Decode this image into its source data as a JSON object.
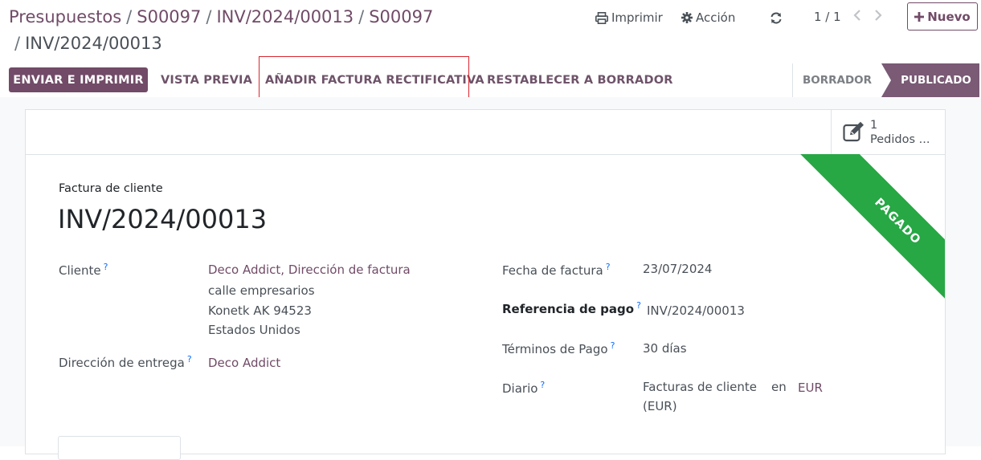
{
  "breadcrumb": {
    "items": [
      "Presupuestos",
      "S00097",
      "INV/2024/00013",
      "S00097"
    ],
    "current": "INV/2024/00013",
    "separator": "/"
  },
  "toolbar": {
    "print_label": "Imprimir",
    "action_label": "Acción",
    "pager": "1 / 1",
    "new_label": "Nuevo"
  },
  "statusbar": {
    "send_print": "ENVIAR E IMPRIMIR",
    "preview": "VISTA PREVIA",
    "credit_note": "AÑADIR FACTURA RECTIFICATIVA",
    "reset_draft": "RESTABLECER A BORRADOR",
    "stages": [
      "BORRADOR",
      "PUBLICADO"
    ],
    "active_stage": "PUBLICADO"
  },
  "smart_button": {
    "count": "1",
    "label": "Pedidos ..."
  },
  "ribbon": "PAGADO",
  "invoice": {
    "type_label": "Factura de cliente",
    "name": "INV/2024/00013",
    "customer_label": "Cliente",
    "customer_lines": [
      "Deco Addict, Dirección de factura",
      "calle empresarios",
      "Konetk AK 94523",
      "Estados Unidos"
    ],
    "delivery_label": "Dirección de entrega",
    "delivery_value": "Deco Addict",
    "date_label": "Fecha de factura",
    "date_value": "23/07/2024",
    "payment_ref_label": "Referencia de pago",
    "payment_ref_value": "INV/2024/00013",
    "terms_label": "Términos de Pago",
    "terms_value": "30 días",
    "journal_label": "Diario",
    "journal_value_1": "Facturas de cliente",
    "journal_value_2": "(EUR)",
    "journal_in": "en",
    "currency": "EUR",
    "help_mark": "?"
  },
  "colors": {
    "brand": "#714b67",
    "paid": "#28a745",
    "highlight": "#d9262e"
  },
  "icons": [
    "print-icon",
    "gear-icon",
    "refresh-icon",
    "chevron-left-icon",
    "chevron-right-icon",
    "plus-icon",
    "edit-icon"
  ]
}
